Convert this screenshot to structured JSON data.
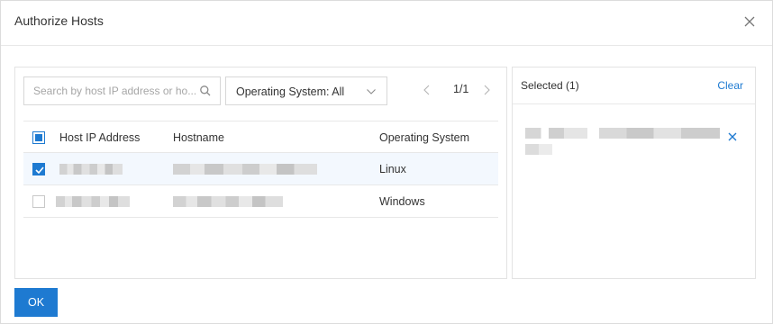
{
  "dialog": {
    "title": "Authorize Hosts"
  },
  "search": {
    "placeholder": "Search by host IP address or ho..."
  },
  "filter": {
    "label": "Operating System: All"
  },
  "pager": {
    "text": "1/1"
  },
  "table": {
    "columns": [
      "Host IP Address",
      "Hostname",
      "Operating System"
    ],
    "rows": [
      {
        "ip": "",
        "hostname": "",
        "os": "Linux",
        "checked": true
      },
      {
        "ip": "",
        "hostname": "",
        "os": "Windows",
        "checked": false
      }
    ]
  },
  "selected": {
    "label": "Selected (1)",
    "clear_label": "Clear"
  },
  "footer": {
    "ok_label": "OK"
  },
  "colors": {
    "accent": "#1e7ad1",
    "selected_row": "#f3f8fe",
    "border": "#e3e3e3"
  },
  "icons": [
    "close-icon",
    "search-icon",
    "chevron-down-icon",
    "chevron-left-icon",
    "chevron-right-icon",
    "check-icon",
    "remove-icon"
  ]
}
